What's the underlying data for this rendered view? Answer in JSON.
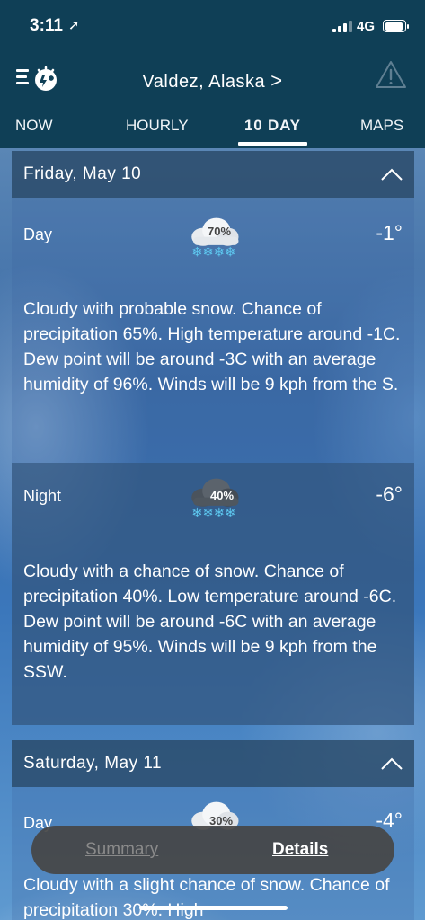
{
  "status_bar": {
    "time": "3:11",
    "network": "4G"
  },
  "header": {
    "location": "Valdez,  Alaska",
    "location_chevron": ">"
  },
  "tabs": [
    {
      "label": "NOW",
      "active": false
    },
    {
      "label": "HOURLY",
      "active": false
    },
    {
      "label": "10 DAY",
      "active": true
    },
    {
      "label": "MAPS",
      "active": false
    }
  ],
  "forecast": [
    {
      "date": "Friday,  May  10",
      "day": {
        "label": "Day",
        "temp": "-1°",
        "precip_badge": "70%",
        "icon": "cloud-snow-icon",
        "description": "Cloudy with probable snow. Chance of precipitation 65%. High temperature around -1C. Dew point will be around -3C with an average humidity of 96%. Winds will be 9 kph from the S."
      },
      "night": {
        "label": "Night",
        "temp": "-6°",
        "precip_badge": "40%",
        "icon": "cloud-snow-night-icon",
        "description": "Cloudy with a chance of snow. Chance of precipitation 40%. Low temperature around -6C. Dew point will be around -6C with an average humidity of 95%. Winds will be 9 kph from the SSW."
      }
    },
    {
      "date": "Saturday,  May  11",
      "day": {
        "label": "Day",
        "temp": "-4°",
        "precip_badge": "30%",
        "icon": "cloud-snow-icon",
        "description": "Cloudy with a slight chance of snow. Chance of precipitation 30%. High"
      }
    }
  ],
  "view_toggle": {
    "summary": "Summary",
    "details": "Details",
    "selected": "Details"
  },
  "colors": {
    "header_bg": "#0f3f56",
    "snowflake": "#5ec8f0"
  }
}
